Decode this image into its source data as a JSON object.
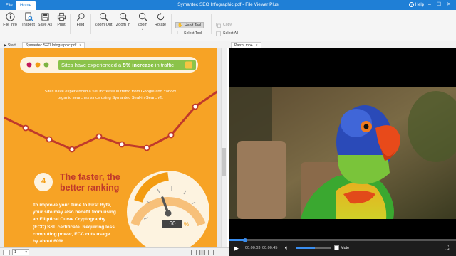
{
  "window": {
    "title": "Symantec SEO Infographic.pdf - File Viewer Plus",
    "help_label": "Help"
  },
  "menu_tabs": {
    "file": "File",
    "home": "Home"
  },
  "ribbon": {
    "file_info": "File Info",
    "inspect": "Inspect",
    "save_as": "Save As",
    "print": "Print",
    "find": "Find",
    "zoom_out": "Zoom Out",
    "zoom_in": "Zoom In",
    "zoom": "Zoom",
    "rotate": "Rotate",
    "hand_tool": "Hand Tool",
    "select_tool": "Select Tool",
    "copy": "Copy",
    "select_all": "Select All"
  },
  "doc_tabs": {
    "start": "Start",
    "pdf": "Symantec SEO Infographic.pdf",
    "video": "Parrot.mp4"
  },
  "pdf": {
    "banner_text_pre": "Sites have experienced a ",
    "banner_text_bold": "5% increase",
    "banner_text_post": " in traffic",
    "stat_line1": "Sites have experienced a 5% increase in traffic from Google and Yahoo!",
    "stat_line2": "organic searches since using Symantec Seal-in-Search®.",
    "section_number": "4",
    "heading_line1": "The faster, the",
    "heading_line2": "better ranking",
    "body_lines": [
      "To improve your Time to First Byte,",
      "your site may also benefit from using",
      "an Elliptical Curve Cryptography",
      "(ECC) SSL certificate. Requiring less",
      "computing power, ECC cuts usage",
      "by about 60%."
    ],
    "gauge_value": "60",
    "gauge_unit": "%",
    "colors": {
      "page": "#f7a325",
      "line": "#c0392b",
      "heading": "#c0392b",
      "banner_text": "#f39c12"
    }
  },
  "status": {
    "page_number": "1"
  },
  "video": {
    "current_time": "00:00:03",
    "total_time": "00:00:45",
    "mute_label": "Mute",
    "progress_fraction": 0.07,
    "volume_fraction": 0.55
  }
}
